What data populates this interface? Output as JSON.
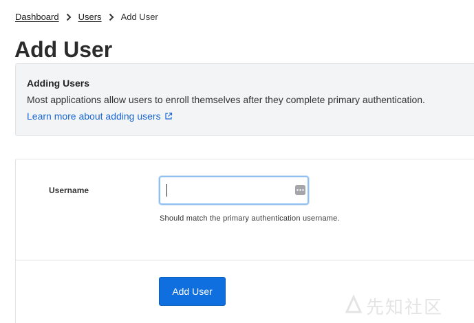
{
  "breadcrumb": {
    "items": [
      "Dashboard",
      "Users"
    ],
    "current": "Add User"
  },
  "page": {
    "title": "Add User"
  },
  "info": {
    "title": "Adding Users",
    "text": "Most applications allow users to enroll themselves after they complete primary authentication.",
    "link_label": "Learn more about adding users"
  },
  "form": {
    "username_label": "Username",
    "username_value": "",
    "username_help": "Should match the primary authentication username.",
    "submit_label": "Add User"
  },
  "watermark": {
    "text": "先知社区"
  },
  "icons": {
    "separator": "chevron-right-icon",
    "external_link": "external-link-icon",
    "password_manager": "password-manager-icon"
  },
  "colors": {
    "accent": "#0f6fde",
    "link": "#1967d2",
    "info_bg": "#f3f4f5",
    "focus_border": "#8fbff0"
  }
}
